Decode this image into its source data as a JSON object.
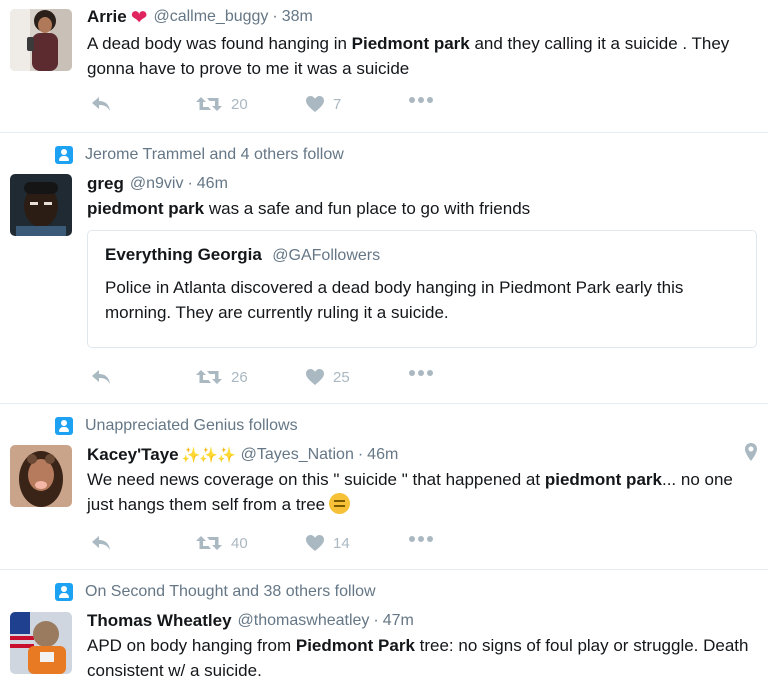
{
  "colors": {
    "link_blue": "#1da1f2",
    "meta_gray": "#657786",
    "action_gray": "#aab8c2",
    "divider": "#e6ecf0"
  },
  "tweets": [
    {
      "context": "",
      "name": "Arrie",
      "emoji": "❤",
      "handle": "@callme_buggy",
      "time": "38m",
      "text_html": "A dead body was found hanging in <b>Piedmont park</b> and they calling it a suicide . They gonna have to prove to me it was a suicide",
      "retweets": "20",
      "likes": "7"
    },
    {
      "context": "Jerome Trammel and 4 others follow",
      "name": "greg",
      "handle": "@n9viv",
      "time": "46m",
      "text_html": "<b>piedmont park</b> was a safe and fun place to go with friends",
      "quote": {
        "name": "Everything Georgia",
        "handle": "@GAFollowers",
        "text": "Police in Atlanta discovered a dead body hanging in Piedmont Park early this morning. They are currently ruling it a suicide."
      },
      "retweets": "26",
      "likes": "25"
    },
    {
      "context": "Unappreciated Genius follows",
      "name": "Kacey'Taye",
      "emoji": "✨✨✨",
      "handle": "@Tayes_Nation",
      "time": "46m",
      "text_html": "We need news coverage on this \" suicide \" that happened at <b>piedmont park</b>... no one just hangs them self from a tree",
      "retweets": "40",
      "likes": "14"
    },
    {
      "context": "On Second Thought and 38 others follow",
      "name": "Thomas Wheatley",
      "handle": "@thomaswheatley",
      "time": "47m",
      "text_html": "APD on body hanging from <b>Piedmont Park</b> tree: no signs of foul play or struggle. Death consistent w/ a suicide."
    }
  ],
  "icons": {
    "reply": "reply-arrow",
    "retweet": "retweet-arrows",
    "like": "heart",
    "more": "three-dots",
    "context": "person-badge",
    "geo": "location-pin",
    "face": "expressionless-face"
  },
  "dot": "·"
}
